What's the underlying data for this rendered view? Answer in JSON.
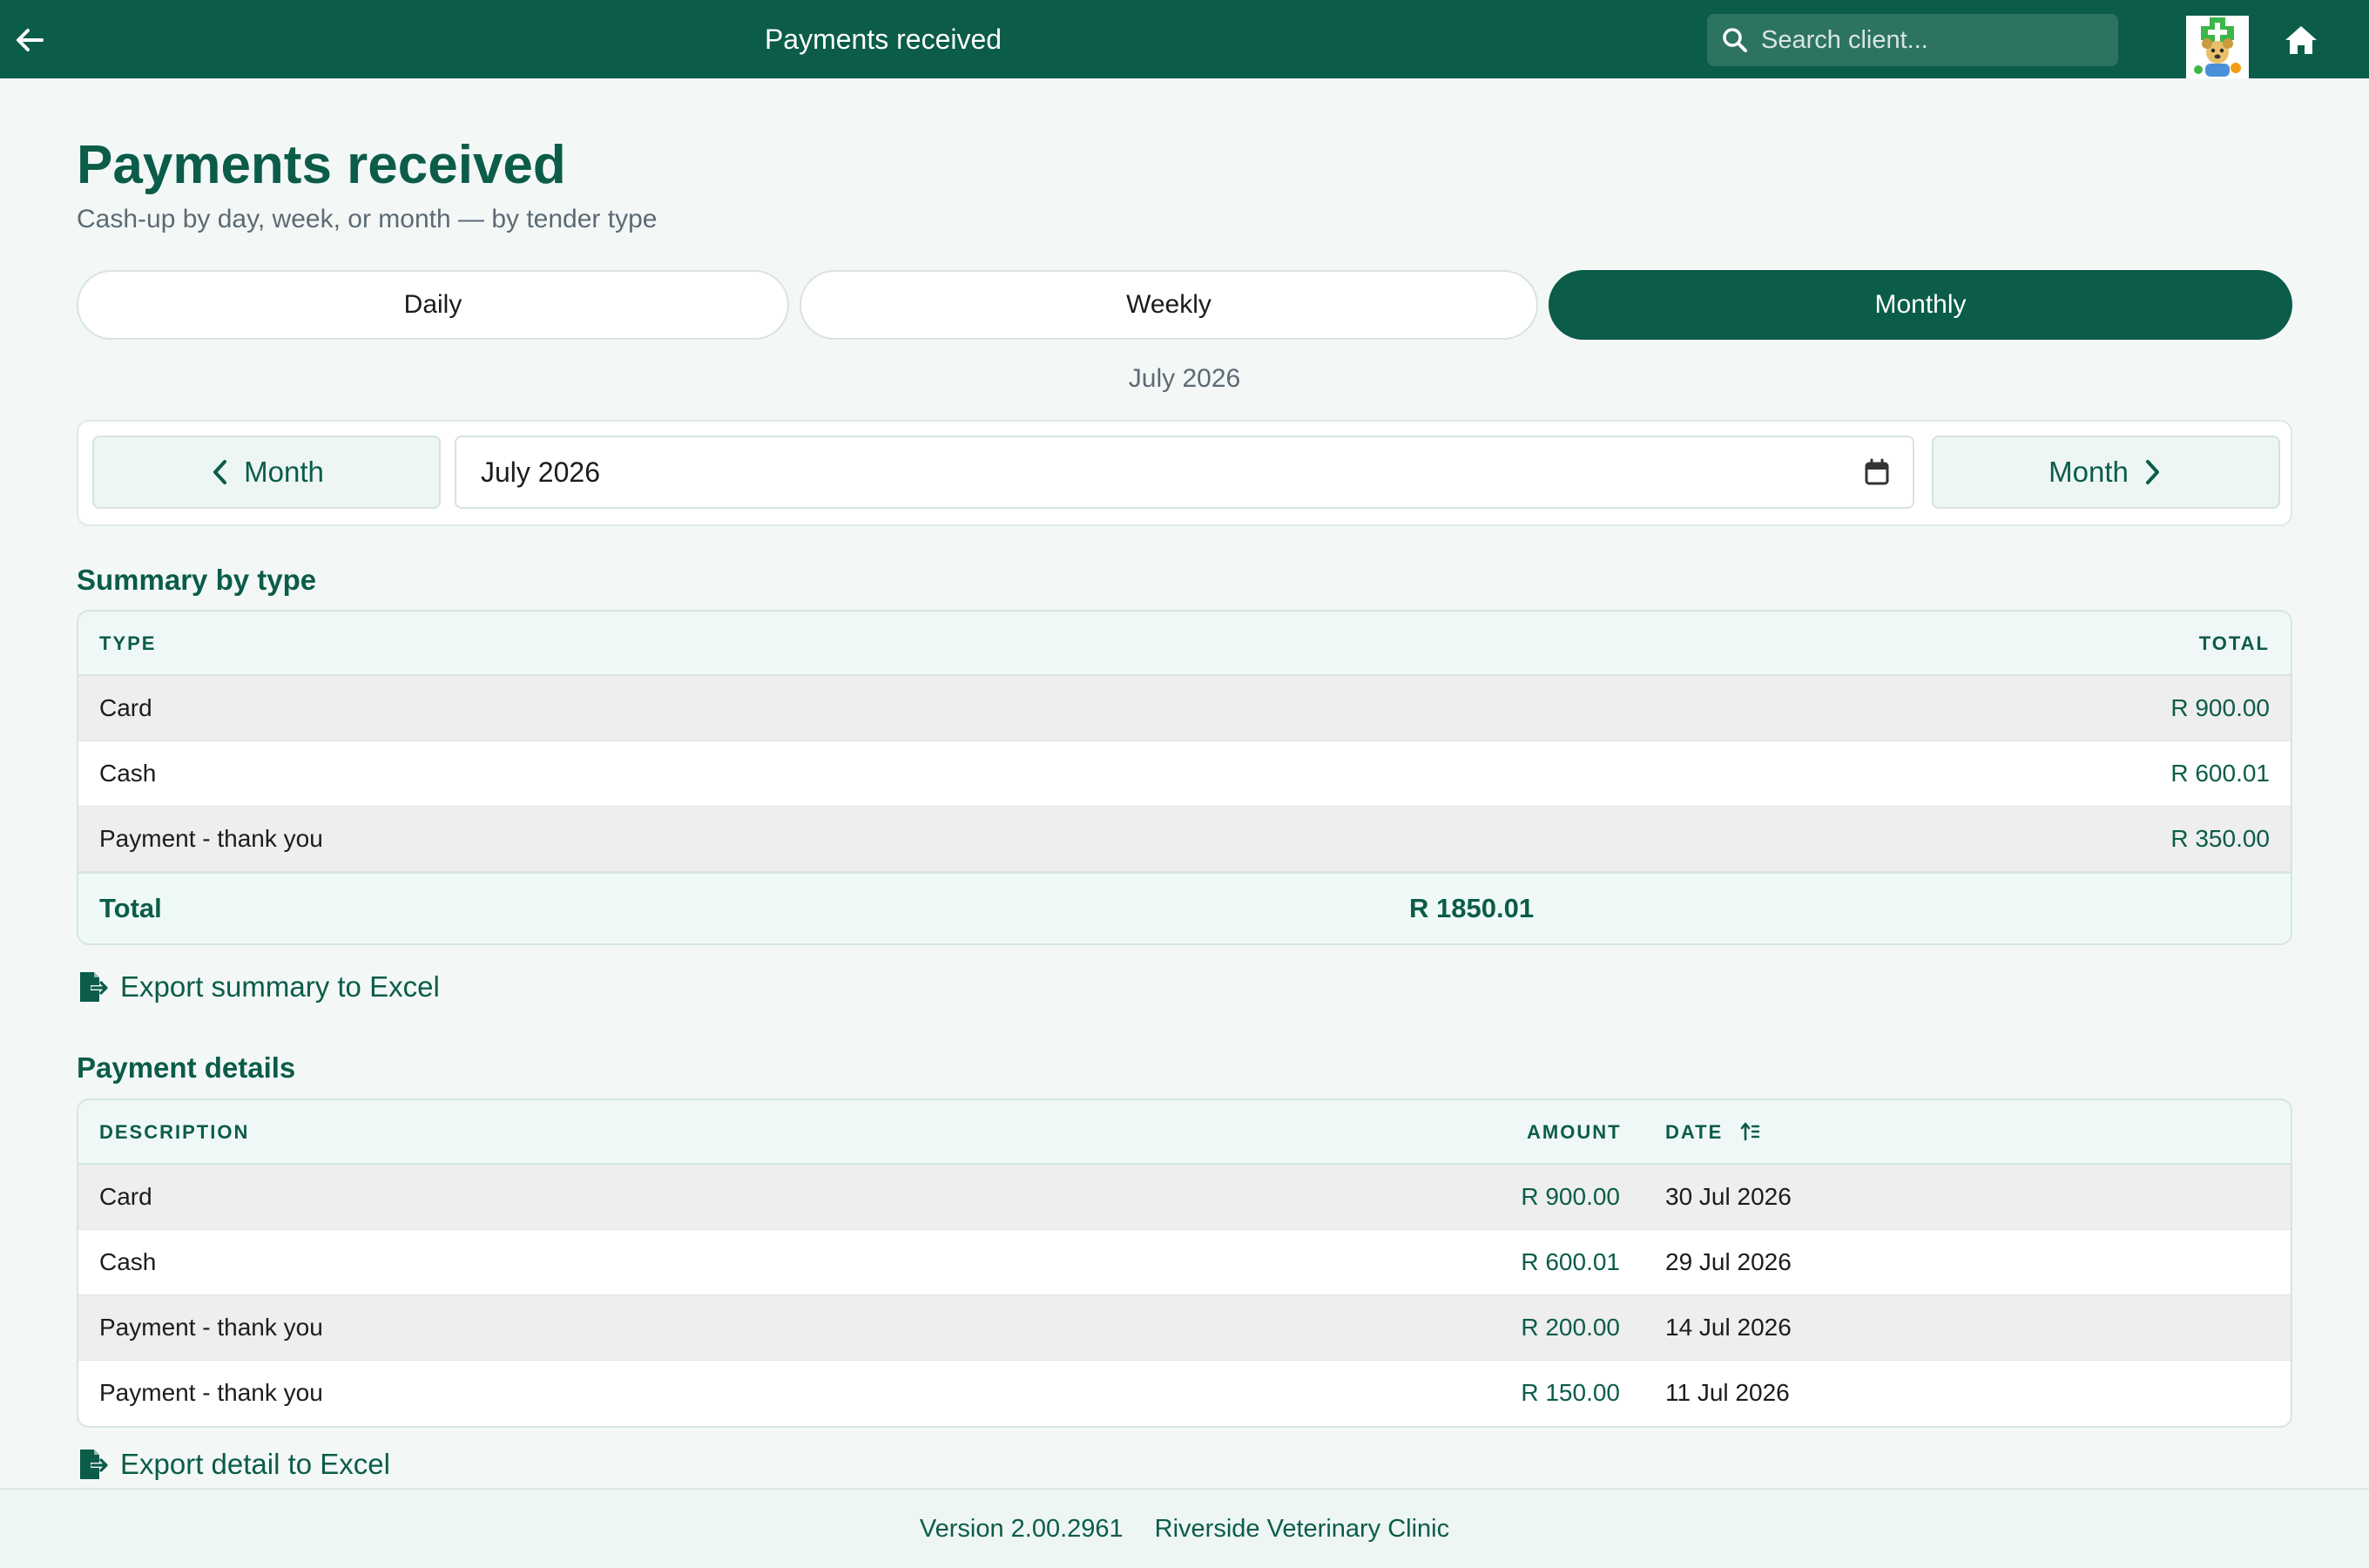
{
  "header": {
    "title": "Payments received",
    "search_placeholder": "Search client..."
  },
  "page": {
    "title": "Payments received",
    "subtitle": "Cash-up by day, week, or month — by tender type"
  },
  "tabs": [
    {
      "label": "Daily",
      "active": false
    },
    {
      "label": "Weekly",
      "active": false
    },
    {
      "label": "Monthly",
      "active": true
    }
  ],
  "period_label": "July 2026",
  "nav": {
    "prev_label": "Month",
    "next_label": "Month",
    "date_value": "July 2026"
  },
  "summary": {
    "title": "Summary by type",
    "col_type": "TYPE",
    "col_total": "TOTAL",
    "rows": [
      {
        "type": "Card",
        "total": "R 900.00"
      },
      {
        "type": "Cash",
        "total": "R 600.01"
      },
      {
        "type": "Payment - thank you",
        "total": "R 350.00"
      }
    ],
    "total_label": "Total",
    "total_value": "R 1850.01",
    "export_label": "Export summary to Excel"
  },
  "details": {
    "title": "Payment details",
    "col_description": "DESCRIPTION",
    "col_amount": "AMOUNT",
    "col_date": "DATE",
    "rows": [
      {
        "description": "Card",
        "amount": "R 900.00",
        "date": "30 Jul 2026"
      },
      {
        "description": "Cash",
        "amount": "R 600.01",
        "date": "29 Jul 2026"
      },
      {
        "description": "Payment - thank you",
        "amount": "R 200.00",
        "date": "14 Jul 2026"
      },
      {
        "description": "Payment - thank you",
        "amount": "R 150.00",
        "date": "11 Jul 2026"
      }
    ],
    "export_label": "Export detail to Excel"
  },
  "footer": {
    "version": "Version 2.00.2961",
    "clinic": "Riverside Veterinary Clinic"
  },
  "colors": {
    "brand": "#0b5c49",
    "background": "#f3f8f7",
    "row_shade": "#eeeeee"
  }
}
